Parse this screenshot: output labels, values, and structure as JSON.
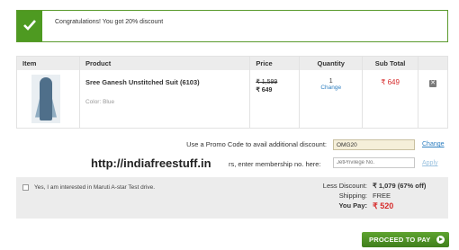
{
  "banner": {
    "message": "Congratulations! You got 20% discount",
    "icon": "check-icon",
    "accent": "#4e9a21"
  },
  "cart": {
    "headers": {
      "item": "Item",
      "product": "Product",
      "price": "Price",
      "quantity": "Quantity",
      "subtotal": "Sub Total"
    },
    "items": [
      {
        "name": "Sree Ganesh Unstitched Suit (6103)",
        "color": "Color: Blue",
        "old_price": "₹ 1,599",
        "new_price": "₹ 649",
        "quantity": "1",
        "change": "Change",
        "subtotal": "₹ 649",
        "remove_icon": "remove-icon"
      }
    ]
  },
  "promo": {
    "label": "Use a Promo Code to avail additional discount:",
    "value": "OMG20",
    "action": "Change"
  },
  "watermark": "http://indiafreestuff.in",
  "membership": {
    "label": "rs, enter membership no. here:",
    "placeholder": "JetPrivilege No.",
    "action": "Apply"
  },
  "summary": {
    "checkbox_label": "Yes, I am interested in Maruti A-star Test drive.",
    "less_discount_label": "Less Discount:",
    "less_discount_value": "₹ 1,079 (67% off)",
    "shipping_label": "Shipping:",
    "shipping_value": "FREE",
    "you_pay_label": "You Pay:",
    "you_pay_value": "₹ 520"
  },
  "proceed": {
    "label": "PROCEED TO PAY",
    "icon": "arrow-right-icon"
  }
}
